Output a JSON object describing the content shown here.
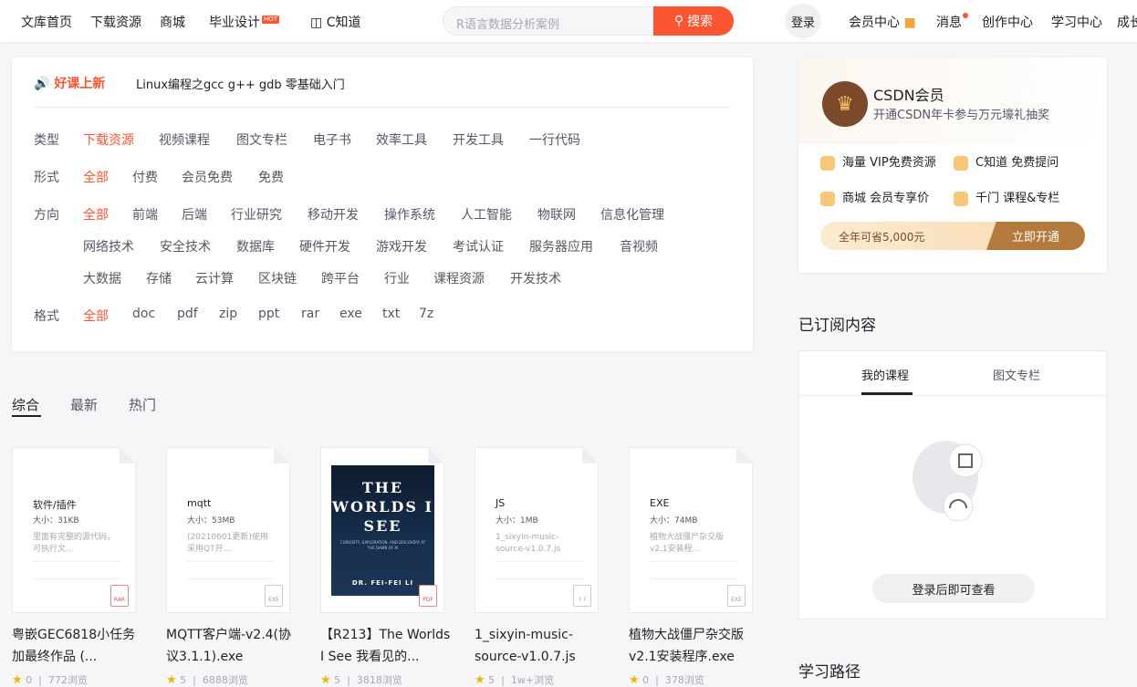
{
  "nav": {
    "items": [
      "文库首页",
      "下载资源",
      "商城",
      "毕业设计",
      "C知道"
    ],
    "hot": "HOT",
    "search_placeholder": "R语言数据分析案例",
    "search_btn": "搜索",
    "login": "登录",
    "right": [
      "会员中心",
      "消息",
      "创作中心",
      "学习中心",
      "成长"
    ]
  },
  "promo": {
    "label": "好课上新",
    "title": "Linux编程之gcc g++ gdb 零基础入门"
  },
  "filters": {
    "type_label": "类型",
    "type": [
      "下载资源",
      "视频课程",
      "图文专栏",
      "电子书",
      "效率工具",
      "开发工具",
      "一行代码"
    ],
    "form_label": "形式",
    "form": [
      "全部",
      "付费",
      "会员免费",
      "免费"
    ],
    "dir_label": "方向",
    "dir1": [
      "全部",
      "前端",
      "后端",
      "行业研究",
      "移动开发",
      "操作系统",
      "人工智能",
      "物联网",
      "信息化管理"
    ],
    "dir2": [
      "网络技术",
      "安全技术",
      "数据库",
      "硬件开发",
      "游戏开发",
      "考试认证",
      "服务器应用",
      "音视频"
    ],
    "dir3": [
      "大数据",
      "存储",
      "云计算",
      "区块链",
      "跨平台",
      "行业",
      "课程资源",
      "开发技术"
    ],
    "fmt_label": "格式",
    "fmt": [
      "全部",
      "doc",
      "pdf",
      "zip",
      "ppt",
      "rar",
      "exe",
      "txt",
      "7z"
    ]
  },
  "sort_tabs": [
    "综合",
    "最新",
    "热门"
  ],
  "cards": [
    {
      "type": "软件/插件",
      "size": "大小：31KB",
      "desc": "里面有完整的源代码，可执行文...",
      "ext": "RAR",
      "title": "粤嵌GEC6818小任务加最终作品 (...",
      "likes": "0",
      "views": "772浏览"
    },
    {
      "type": "mqtt",
      "size": "大小：53MB",
      "desc": "(20210601更新)使用采用QT开...",
      "ext": "EXE",
      "title": "MQTT客户端-v2.4(协议3.1.1).exe",
      "likes": "5",
      "views": "6888浏览"
    },
    {
      "type": "",
      "size": "",
      "desc": "",
      "ext": "PDF",
      "title": "【R213】The Worlds I See 我看见的...",
      "likes": "5",
      "views": "3818浏览"
    },
    {
      "type": "JS",
      "size": "大小：1MB",
      "desc": "1_sixyin-music-source-v1.0.7.js",
      "ext": "? ?",
      "title": "1_sixyin-music-source-v1.0.7.js",
      "likes": "5",
      "views": "1w+浏览"
    },
    {
      "type": "EXE",
      "size": "大小：74MB",
      "desc": "植物大战僵尸杂交版v2.1安装程...",
      "ext": "EXE",
      "title": "植物大战僵尸杂交版v2.1安装程序.exe",
      "likes": "0",
      "views": "378浏览"
    }
  ],
  "book": {
    "title": "THE WORLDS I SEE",
    "subtitle": "CURIOSITY, EXPLORATION, AND DISCOVERY AT THE DAWN OF AI",
    "author": "DR. FEI-FEI LI"
  },
  "vip": {
    "title": "CSDN会员",
    "sub": "开通CSDN年卡参与万元壕礼抽奖",
    "f1": "海量",
    "f1b": "VIP免费资源",
    "f2": "C知道",
    "f2b": "免费提问",
    "f3": "商城",
    "f3b": "会员专享价",
    "f4": "千门",
    "f4b": "课程&专栏",
    "save": "全年可省5,000元",
    "open": "立即开通"
  },
  "subscribed": {
    "head": "已订阅内容",
    "tabs": [
      "我的课程",
      "图文专栏"
    ],
    "btn": "登录后即可查看"
  },
  "path_head": "学习路径"
}
